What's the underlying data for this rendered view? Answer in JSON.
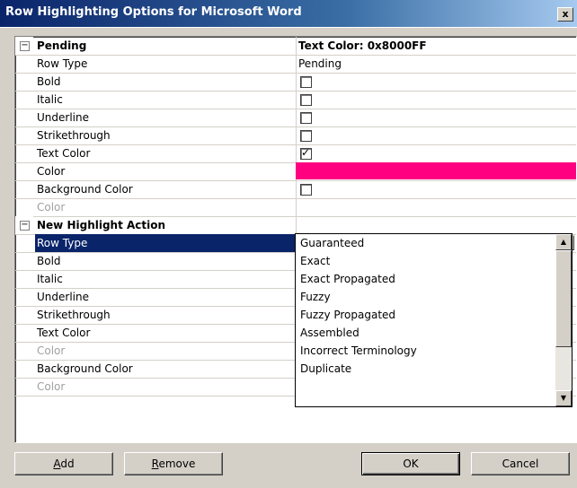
{
  "window": {
    "title": "Row Highlighting Options for Microsoft Word",
    "close_glyph": "x"
  },
  "grid": {
    "category_pending": {
      "label": "Pending",
      "summary": "Text Color: 0x8000FF",
      "expander": "−",
      "rows": [
        {
          "name": "Row Type",
          "value": "Pending",
          "kind": "text"
        },
        {
          "name": "Bold",
          "kind": "checkbox",
          "checked": false
        },
        {
          "name": "Italic",
          "kind": "checkbox",
          "checked": false
        },
        {
          "name": "Underline",
          "kind": "checkbox",
          "checked": false
        },
        {
          "name": "Strikethrough",
          "kind": "checkbox",
          "checked": false
        },
        {
          "name": "Text Color",
          "kind": "checkbox",
          "checked": true,
          "check_glyph": "✓"
        },
        {
          "name": "Color",
          "kind": "color",
          "color": "#ff0080"
        },
        {
          "name": "Background Color",
          "kind": "checkbox",
          "checked": false
        },
        {
          "name": "Color",
          "kind": "disabled"
        }
      ]
    },
    "category_new": {
      "label": "New Highlight Action",
      "expander": "−",
      "rows": [
        {
          "name": "Row Type",
          "selected": true
        },
        {
          "name": "Bold"
        },
        {
          "name": "Italic"
        },
        {
          "name": "Underline"
        },
        {
          "name": "Strikethrough"
        },
        {
          "name": "Text Color"
        },
        {
          "name": "Color",
          "disabled": true
        },
        {
          "name": "Background Color"
        },
        {
          "name": "Color",
          "disabled": true
        }
      ]
    }
  },
  "row_type_dropdown": {
    "arrow_glyph": "▼",
    "options": [
      "Guaranteed",
      "Exact",
      "Exact Propagated",
      "Fuzzy",
      "Fuzzy Propagated",
      "Assembled",
      "Incorrect Terminology",
      "Duplicate"
    ],
    "scroll_up_glyph": "▲",
    "scroll_down_glyph": "▼"
  },
  "buttons": {
    "add_pre": "",
    "add_accel": "A",
    "add_post": "dd",
    "remove_pre": "",
    "remove_accel": "R",
    "remove_post": "emove",
    "ok": "OK",
    "cancel": "Cancel"
  },
  "colors": {
    "title_bar": "#0a246a",
    "selection": "#0a246a",
    "pending_color_swatch": "#ff0080",
    "dialog_face": "#d4d0c8"
  }
}
